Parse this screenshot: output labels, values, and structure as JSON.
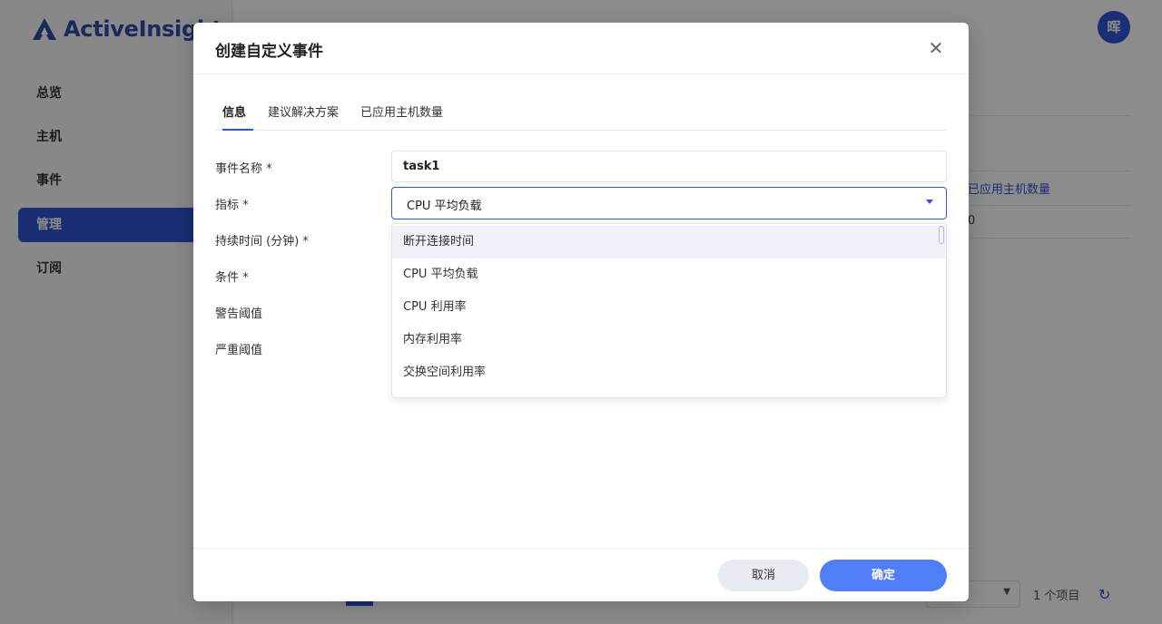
{
  "app": {
    "brand": "ActiveInsight",
    "avatar_initial": "晖"
  },
  "sidebar": {
    "items": [
      {
        "label": "总览"
      },
      {
        "label": "主机"
      },
      {
        "label": "事件"
      },
      {
        "label": "管理"
      },
      {
        "label": "订阅"
      }
    ]
  },
  "background": {
    "column_header": "已应用主机数量",
    "cell_value": "0",
    "pager_count": "1 个项目"
  },
  "modal": {
    "title": "创建自定义事件",
    "tabs": [
      {
        "label": "信息"
      },
      {
        "label": "建议解决方案"
      },
      {
        "label": "已应用主机数量"
      }
    ],
    "form": {
      "event_name_label": "事件名称 *",
      "event_name_value": "task1",
      "metric_label": "指标 *",
      "metric_value": "CPU 平均负载",
      "duration_label": "持续时间 (分钟) *",
      "condition_label": "条件 *",
      "warning_label": "警告阈值",
      "critical_label": "严重阈值"
    },
    "dropdown_options": [
      {
        "label": "断开连接时间"
      },
      {
        "label": "CPU 平均负载"
      },
      {
        "label": "CPU 利用率"
      },
      {
        "label": "内存利用率"
      },
      {
        "label": "交换空间利用率"
      }
    ],
    "footer": {
      "cancel_label": "取消",
      "ok_label": "确定"
    }
  },
  "colors": {
    "accent": "#2f55d4",
    "primary_button": "#4f7ef7",
    "overlay": "rgba(0,0,0,0.45)"
  },
  "icons": {
    "close": "close-icon",
    "caret": "caret-down-icon",
    "logo": "logo-icon",
    "refresh": "refresh-icon"
  }
}
